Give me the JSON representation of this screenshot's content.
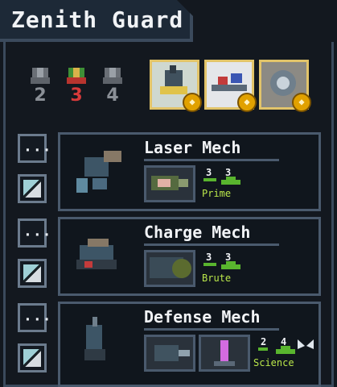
{
  "title": "Zenith Guard",
  "medals": [
    {
      "value": "2",
      "color": "#8a8f96"
    },
    {
      "value": "3",
      "color": "#d73a3a"
    },
    {
      "value": "4",
      "color": "#8a8f96"
    }
  ],
  "achievements": [
    {
      "icon": "mech-achievement-icon"
    },
    {
      "icon": "laser-achievement-icon"
    },
    {
      "icon": "shield-achievement-icon"
    }
  ],
  "mechs": [
    {
      "name": "Laser Mech",
      "class": "Prime",
      "move": "3",
      "health": "3",
      "slots": 1
    },
    {
      "name": "Charge Mech",
      "class": "Brute",
      "move": "3",
      "health": "3",
      "slots": 1
    },
    {
      "name": "Defense Mech",
      "class": "Science",
      "move": "2",
      "health": "4",
      "slots": 2
    }
  ]
}
